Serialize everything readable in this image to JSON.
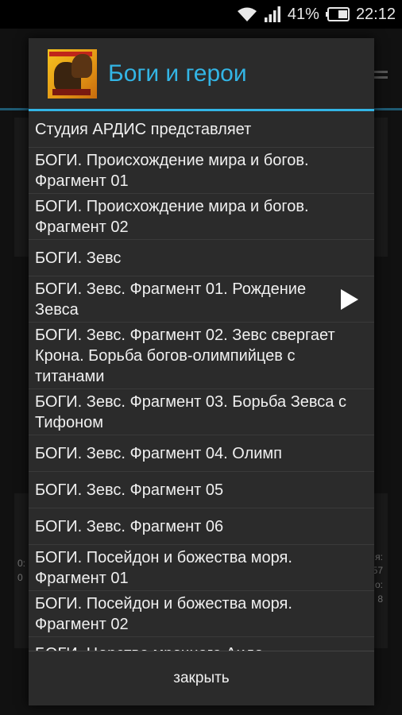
{
  "status_bar": {
    "battery": "41%",
    "time": "22:12"
  },
  "background": {
    "left_a": "0:",
    "left_b": "0",
    "right_a": "я:",
    "right_b": "57",
    "right_c": "о:",
    "right_d": "8"
  },
  "dialog": {
    "title": "Боги и герои",
    "items": [
      {
        "label": "Студия АРДИС представляет"
      },
      {
        "label": "БОГИ. Происхождение мира и богов. Фрагмент 01"
      },
      {
        "label": "БОГИ. Происхождение мира и богов. Фрагмент 02"
      },
      {
        "label": "БОГИ. Зевс"
      },
      {
        "label": "БОГИ. Зевс. Фрагмент 01. Рождение Зевса"
      },
      {
        "label": "БОГИ. Зевс. Фрагмент 02. Зевс свергает Крона. Борьба богов-олимпийцев с титанами"
      },
      {
        "label": "БОГИ. Зевс. Фрагмент 03. Борьба Зевса с Тифоном"
      },
      {
        "label": "БОГИ. Зевс. Фрагмент 04. Олимп"
      },
      {
        "label": "БОГИ. Зевс. Фрагмент 05"
      },
      {
        "label": "БОГИ. Зевс. Фрагмент 06"
      },
      {
        "label": "БОГИ. Посейдон и божества моря. Фрагмент 01"
      },
      {
        "label": "БОГИ. Посейдон и божества моря. Фрагмент 02"
      },
      {
        "label": "БОГИ. Царство мрачного Аида"
      }
    ],
    "playing_index": 4,
    "close_label": "закрыть"
  },
  "colors": {
    "accent": "#33b5e5",
    "dialog_bg": "#2b2b2b"
  }
}
